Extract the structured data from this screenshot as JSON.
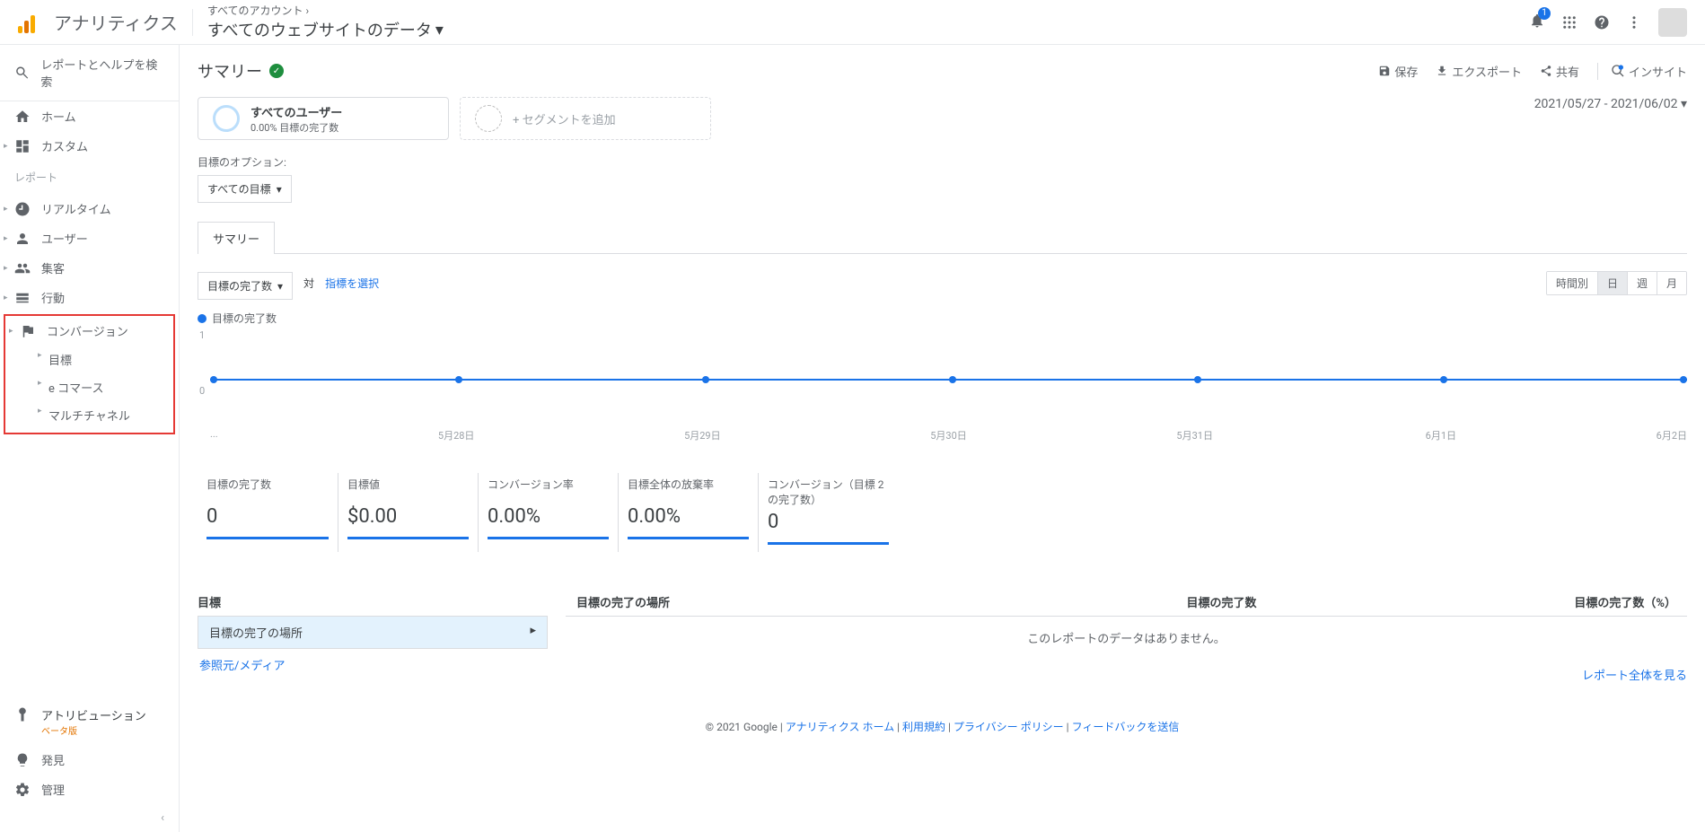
{
  "header": {
    "product": "アナリティクス",
    "breadcrumb_top": "すべてのアカウント ›",
    "breadcrumb_bottom": "すべてのウェブサイトのデータ",
    "notification_count": "1"
  },
  "sidebar": {
    "search_placeholder": "レポートとヘルプを検索",
    "home": "ホーム",
    "custom": "カスタム",
    "report_label": "レポート",
    "realtime": "リアルタイム",
    "user": "ユーザー",
    "acquisition": "集客",
    "behavior": "行動",
    "conversion": "コンバージョン",
    "conv_sub": {
      "goal": "目標",
      "ecom": "e コマース",
      "multi": "マルチチャネル"
    },
    "attribution": "アトリビューション",
    "beta": "ベータ版",
    "discover": "発見",
    "admin": "管理"
  },
  "page": {
    "title": "サマリー",
    "actions": {
      "save": "保存",
      "export": "エクスポート",
      "share": "共有",
      "insight": "インサイト"
    },
    "segment_all_users": "すべてのユーザー",
    "segment_sub": "0.00% 目標の完了数",
    "add_segment": "+ セグメントを追加",
    "date_range": "2021/05/27 - 2021/06/02",
    "goal_option_label": "目標のオプション:",
    "goal_select": "すべての目標",
    "tab_summary": "サマリー",
    "metric_select": "目標の完了数",
    "vs": "対",
    "choose_metric": "指標を選択",
    "time_toggles": {
      "hour": "時間別",
      "day": "日",
      "week": "週",
      "month": "月"
    },
    "legend": "目標の完了数"
  },
  "chart_data": {
    "type": "line",
    "categories": [
      "...",
      "5月28日",
      "5月29日",
      "5月30日",
      "5月31日",
      "6月1日",
      "6月2日"
    ],
    "values": [
      0,
      0,
      0,
      0,
      0,
      0,
      0
    ],
    "ylabel": "",
    "ylim": [
      0,
      1
    ],
    "title": "目標の完了数"
  },
  "metrics": [
    {
      "label": "目標の完了数",
      "value": "0"
    },
    {
      "label": "目標値",
      "value": "$0.00"
    },
    {
      "label": "コンバージョン率",
      "value": "0.00%"
    },
    {
      "label": "目標全体の放棄率",
      "value": "0.00%"
    },
    {
      "label": "コンバージョン（目標 2 の完了数）",
      "value": "0"
    }
  ],
  "tables": {
    "left_header": "目標",
    "selected_row": "目標の完了の場所",
    "link_row": "参照元/メディア",
    "right_cols": {
      "c1": "目標の完了の場所",
      "c2": "目標の完了数",
      "c3": "目標の完了数（%）"
    },
    "no_data": "このレポートのデータはありません。",
    "view_full": "レポート全体を見る"
  },
  "footer": {
    "copyright": "© 2021 Google",
    "links": {
      "home": "アナリティクス ホーム",
      "terms": "利用規約",
      "privacy": "プライバシー ポリシー",
      "feedback": "フィードバックを送信"
    }
  }
}
